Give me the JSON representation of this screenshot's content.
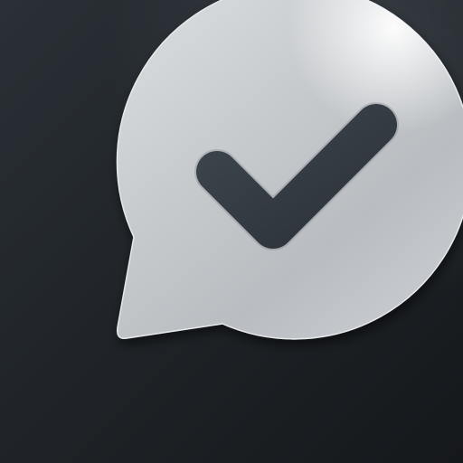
{
  "app_icon": {
    "icon": "speech-bubble-checkmark-icon",
    "background_color": "#1d2125",
    "bubble_color": "#c9ccd0",
    "checkmark_color": "#343b42"
  }
}
